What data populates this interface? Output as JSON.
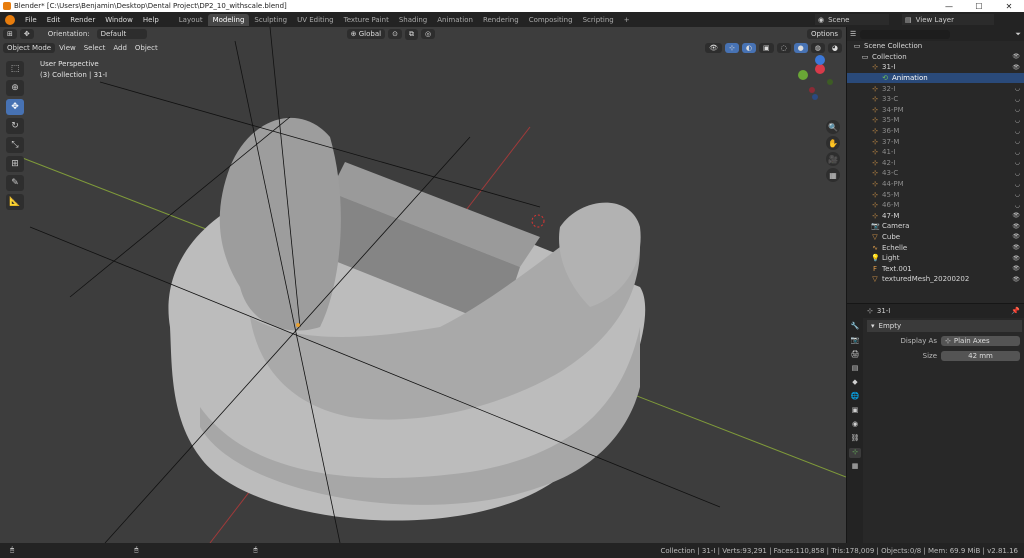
{
  "titlebar": {
    "title": "Blender* [C:\\Users\\Benjamin\\Desktop\\Dental Project\\DP2_10_withscale.blend]",
    "min": "—",
    "max": "☐",
    "close": "✕"
  },
  "menu": [
    "File",
    "Edit",
    "Render",
    "Window",
    "Help"
  ],
  "workspaces": [
    "Layout",
    "Modeling",
    "Sculpting",
    "UV Editing",
    "Texture Paint",
    "Shading",
    "Animation",
    "Rendering",
    "Compositing",
    "Scripting"
  ],
  "workspace_active": "Modeling",
  "scene": "Scene",
  "view_layer": "View Layer",
  "viewport": {
    "mode": "Object Mode",
    "menus": [
      "View",
      "Select",
      "Add",
      "Object"
    ],
    "orientation_label": "Orientation:",
    "orientation": "Default",
    "transform_space": "Global",
    "options": "Options",
    "info_line1": "User Perspective",
    "info_line2": "(3) Collection | 31-I",
    "gizmo_x": "X",
    "gizmo_y": "Y",
    "gizmo_z": "Z"
  },
  "outliner": {
    "root": "Scene Collection",
    "collection": "Collection",
    "items": [
      {
        "name": "31-I",
        "icon": "empty-icon",
        "state": "normal"
      },
      {
        "name": "Animation",
        "icon": "action-icon",
        "state": "selected"
      },
      {
        "name": "32-I",
        "icon": "empty-icon",
        "state": "dim"
      },
      {
        "name": "33-C",
        "icon": "empty-icon",
        "state": "dim"
      },
      {
        "name": "34-PM",
        "icon": "empty-icon",
        "state": "dim"
      },
      {
        "name": "35-M",
        "icon": "empty-icon",
        "state": "dim"
      },
      {
        "name": "36-M",
        "icon": "empty-icon",
        "state": "dim"
      },
      {
        "name": "37-M",
        "icon": "empty-icon",
        "state": "dim"
      },
      {
        "name": "41-I",
        "icon": "empty-icon",
        "state": "dim"
      },
      {
        "name": "42-I",
        "icon": "empty-icon",
        "state": "dim"
      },
      {
        "name": "43-C",
        "icon": "empty-icon",
        "state": "dim"
      },
      {
        "name": "44-PM",
        "icon": "empty-icon",
        "state": "dim"
      },
      {
        "name": "45-M",
        "icon": "empty-icon",
        "state": "dim"
      },
      {
        "name": "46-M",
        "icon": "empty-icon",
        "state": "dim"
      },
      {
        "name": "47-M",
        "icon": "empty-icon",
        "state": "normal"
      },
      {
        "name": "Camera",
        "icon": "camera-icon",
        "state": "normal"
      },
      {
        "name": "Cube",
        "icon": "mesh-icon",
        "state": "normal"
      },
      {
        "name": "Echelle",
        "icon": "curve-icon",
        "state": "normal"
      },
      {
        "name": "Light",
        "icon": "light-icon",
        "state": "normal"
      },
      {
        "name": "Text.001",
        "icon": "text-icon",
        "state": "normal"
      },
      {
        "name": "texturedMesh_20200202",
        "icon": "mesh-icon",
        "state": "normal"
      }
    ]
  },
  "properties": {
    "object_name": "31-I",
    "panel": "Empty",
    "display_as_label": "Display As",
    "display_as": "Plain Axes",
    "size_label": "Size",
    "size": "42 mm"
  },
  "status": "Collection | 31-I | Verts:93,291 | Faces:110,858 | Tris:178,009 | Objects:0/8 | Mem: 69.9 MiB | v2.81.16"
}
